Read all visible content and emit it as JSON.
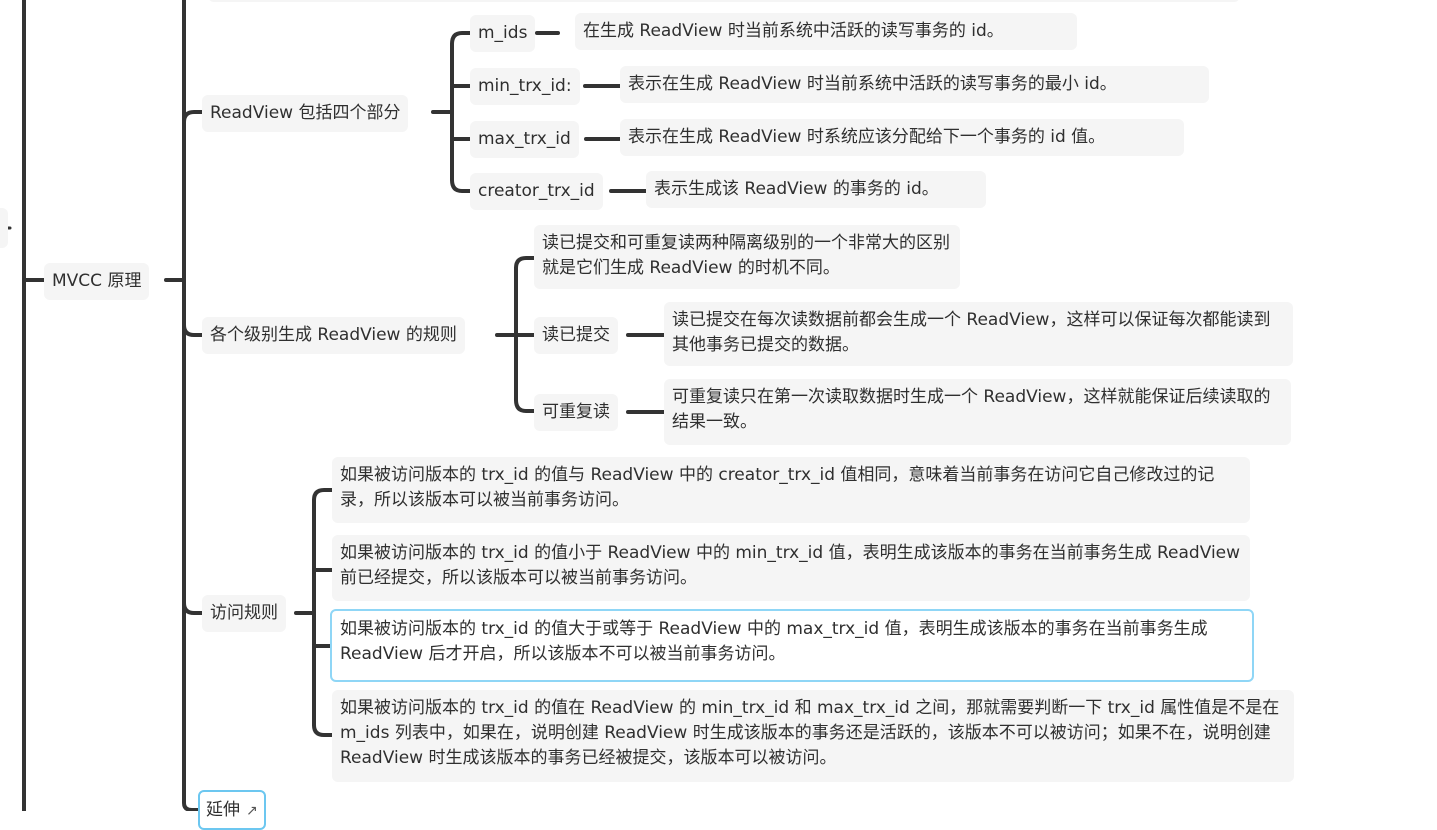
{
  "colors": {
    "line": "#333333",
    "node_bg": "#f5f5f5",
    "selected_border": "#8fd6f6"
  },
  "nodes": {
    "mvcc": "MVCC 原理",
    "readview_parts": "ReadView 包括四个部分",
    "m_ids": "m_ids",
    "m_ids_desc": "在生成 ReadView 时当前系统中活跃的读写事务的 id。",
    "min_trx_id": "min_trx_id:",
    "min_trx_id_desc": "表示在生成 ReadView 时当前系统中活跃的读写事务的最小 id。",
    "max_trx_id": "max_trx_id",
    "max_trx_id_desc": "表示在生成 ReadView 时系统应该分配给下一个事务的 id 值。",
    "creator_trx_id": "creator_trx_id",
    "creator_trx_id_desc": "表示生成该 ReadView 的事务的 id。",
    "levels_rule": "各个级别生成 ReadView 的规则",
    "levels_intro": "读已提交和可重复读两种隔离级别的一个非常大的区别就是它们生成 ReadView 的时机不同。",
    "read_committed": "读已提交",
    "read_committed_desc": "读已提交在每次读数据前都会生成一个 ReadView，这样可以保证每次都能读到其他事务已提交的数据。",
    "repeatable_read": "可重复读",
    "repeatable_read_desc": "可重复读只在第一次读取数据时生成一个 ReadView，这样就能保证后续读取的结果一致。",
    "access_rules": "访问规则",
    "rule1": "如果被访问版本的 trx_id 的值与 ReadView 中的 creator_trx_id 值相同，意味着当前事务在访问它自己修改过的记录，所以该版本可以被当前事务访问。",
    "rule2": "如果被访问版本的 trx_id 的值小于 ReadView 中的 min_trx_id 值，表明生成该版本的事务在当前事务生成 ReadView 前已经提交，所以该版本可以被当前事务访问。",
    "rule3": "如果被访问版本的 trx_id 的值大于或等于 ReadView 中的 max_trx_id 值，表明生成该版本的事务在当前事务生成 ReadView 后才开启，所以该版本不可以被当前事务访问。",
    "rule4": "如果被访问版本的 trx_id 的值在 ReadView 的 min_trx_id 和 max_trx_id 之间，那就需要判断一下 trx_id 属性值是不是在 m_ids 列表中，如果在，说明创建 ReadView 时生成该版本的事务还是活跃的，该版本不可以被访问；如果不在，说明创建 ReadView 时生成该版本的事务已经被提交，该版本可以被访问。",
    "extend": "延伸"
  },
  "icons": {
    "extend_link": "external-link-icon"
  }
}
